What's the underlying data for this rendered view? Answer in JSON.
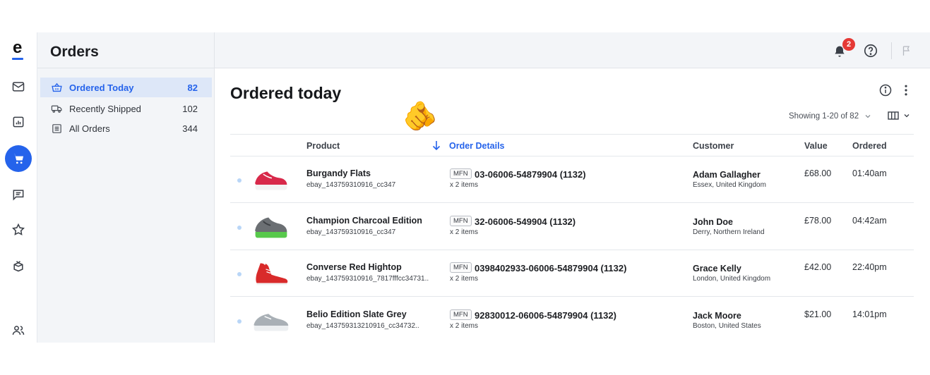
{
  "app": {
    "logo": "e"
  },
  "rail_icons": [
    "mail-icon",
    "chart-icon",
    "cart-icon",
    "chat-icon",
    "star-icon",
    "box-icon",
    "users-icon"
  ],
  "sidebar": {
    "title": "Orders",
    "items": [
      {
        "label": "Ordered Today",
        "count": "82",
        "icon": "basket-icon",
        "active": true
      },
      {
        "label": "Recently Shipped",
        "count": "102",
        "icon": "truck-icon",
        "active": false
      },
      {
        "label": "All Orders",
        "count": "344",
        "icon": "list-icon",
        "active": false
      }
    ]
  },
  "topbar": {
    "notification_count": "2"
  },
  "main": {
    "title": "Ordered today",
    "showing": "Showing 1-20 of 82",
    "columns": [
      "Product",
      "Order Details",
      "Customer",
      "Value",
      "Ordered"
    ],
    "sorted_column": "Order Details",
    "rows": [
      {
        "product": "Burgandy Flats",
        "sku": "ebay_143759310916_cc347",
        "tag": "MFN",
        "order": "03-06006-54879904 (1132)",
        "items": "x 2 items",
        "customer": "Adam Gallagher",
        "location": "Essex, United Kingdom",
        "value": "£68.00",
        "time": "01:40am",
        "shoe_color": "#d8294a"
      },
      {
        "product": "Champion Charcoal Edition",
        "sku": "ebay_143759310916_cc347",
        "tag": "MFN",
        "order": "32-06006-549904 (1132)",
        "items": "x 2 items",
        "customer": "John Doe",
        "location": "Derry, Northern Ireland",
        "value": "£78.00",
        "time": "04:42am",
        "shoe_color": "#6b6f73"
      },
      {
        "product": "Converse Red Hightop",
        "sku": "ebay_143759310916_7817fffcc34731..",
        "tag": "MFN",
        "order": "0398402933-06006-54879904 (1132)",
        "items": "x 2 items",
        "customer": "Grace Kelly",
        "location": "London, United Kingdom",
        "value": "£42.00",
        "time": "22:40pm",
        "shoe_color": "#d92a2a"
      },
      {
        "product": "Belio Edition Slate Grey",
        "sku": "ebay_143759313210916_cc34732..",
        "tag": "MFN",
        "order": "92830012-06006-54879904 (1132)",
        "items": "x 2 items",
        "customer": "Jack Moore",
        "location": "Boston, United States",
        "value": "$21.00",
        "time": "14:01pm",
        "shoe_color": "#a9b0b6"
      }
    ]
  },
  "colors": {
    "accent": "#2563eb",
    "badge": "#e53935",
    "sidebar_bg": "#f3f5f8"
  }
}
